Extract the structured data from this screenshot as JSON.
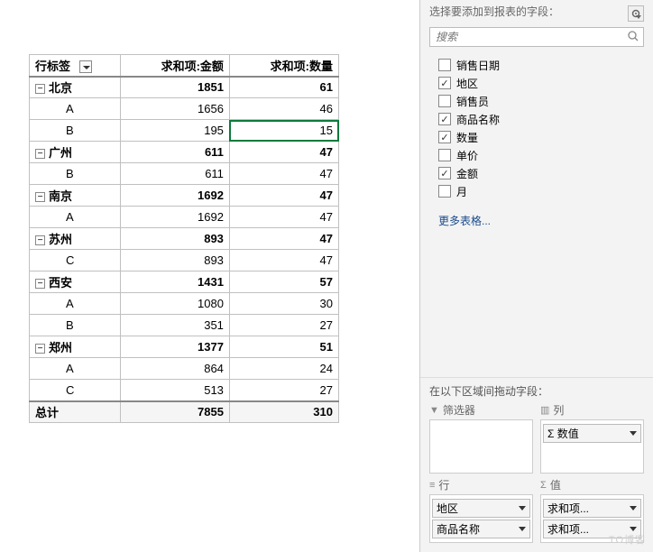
{
  "pivot": {
    "headers": {
      "row": "行标签",
      "amount": "求和项:金额",
      "qty": "求和项:数量"
    },
    "groups": [
      {
        "city": "北京",
        "amount": 1851,
        "qty": 61,
        "children": [
          {
            "label": "A",
            "amount": 1656,
            "qty": 46
          },
          {
            "label": "B",
            "amount": 195,
            "qty": 15,
            "selected_qty": true
          }
        ]
      },
      {
        "city": "广州",
        "amount": 611,
        "qty": 47,
        "children": [
          {
            "label": "B",
            "amount": 611,
            "qty": 47
          }
        ]
      },
      {
        "city": "南京",
        "amount": 1692,
        "qty": 47,
        "children": [
          {
            "label": "A",
            "amount": 1692,
            "qty": 47
          }
        ]
      },
      {
        "city": "苏州",
        "amount": 893,
        "qty": 47,
        "children": [
          {
            "label": "C",
            "amount": 893,
            "qty": 47
          }
        ]
      },
      {
        "city": "西安",
        "amount": 1431,
        "qty": 57,
        "children": [
          {
            "label": "A",
            "amount": 1080,
            "qty": 30
          },
          {
            "label": "B",
            "amount": 351,
            "qty": 27
          }
        ]
      },
      {
        "city": "郑州",
        "amount": 1377,
        "qty": 51,
        "children": [
          {
            "label": "A",
            "amount": 864,
            "qty": 24
          },
          {
            "label": "C",
            "amount": 513,
            "qty": 27
          }
        ]
      }
    ],
    "total": {
      "label": "总计",
      "amount": 7855,
      "qty": 310
    }
  },
  "panel": {
    "title": "选择要添加到报表的字段：",
    "search_placeholder": "搜索",
    "fields": [
      {
        "label": "销售日期",
        "checked": false
      },
      {
        "label": "地区",
        "checked": true
      },
      {
        "label": "销售员",
        "checked": false
      },
      {
        "label": "商品名称",
        "checked": true
      },
      {
        "label": "数量",
        "checked": true
      },
      {
        "label": "单价",
        "checked": false
      },
      {
        "label": "金额",
        "checked": true
      },
      {
        "label": "月",
        "checked": false
      }
    ],
    "more_tables": "更多表格...",
    "drag_label": "在以下区域间拖动字段：",
    "areas": {
      "filter": {
        "label": "筛选器",
        "items": []
      },
      "columns": {
        "label": "列",
        "items": [
          "Σ 数值"
        ]
      },
      "rows": {
        "label": "行",
        "items": [
          "地区",
          "商品名称"
        ]
      },
      "values": {
        "label": "值",
        "items": [
          "求和项...",
          "求和项..."
        ]
      }
    }
  },
  "watermark": "TO博客"
}
